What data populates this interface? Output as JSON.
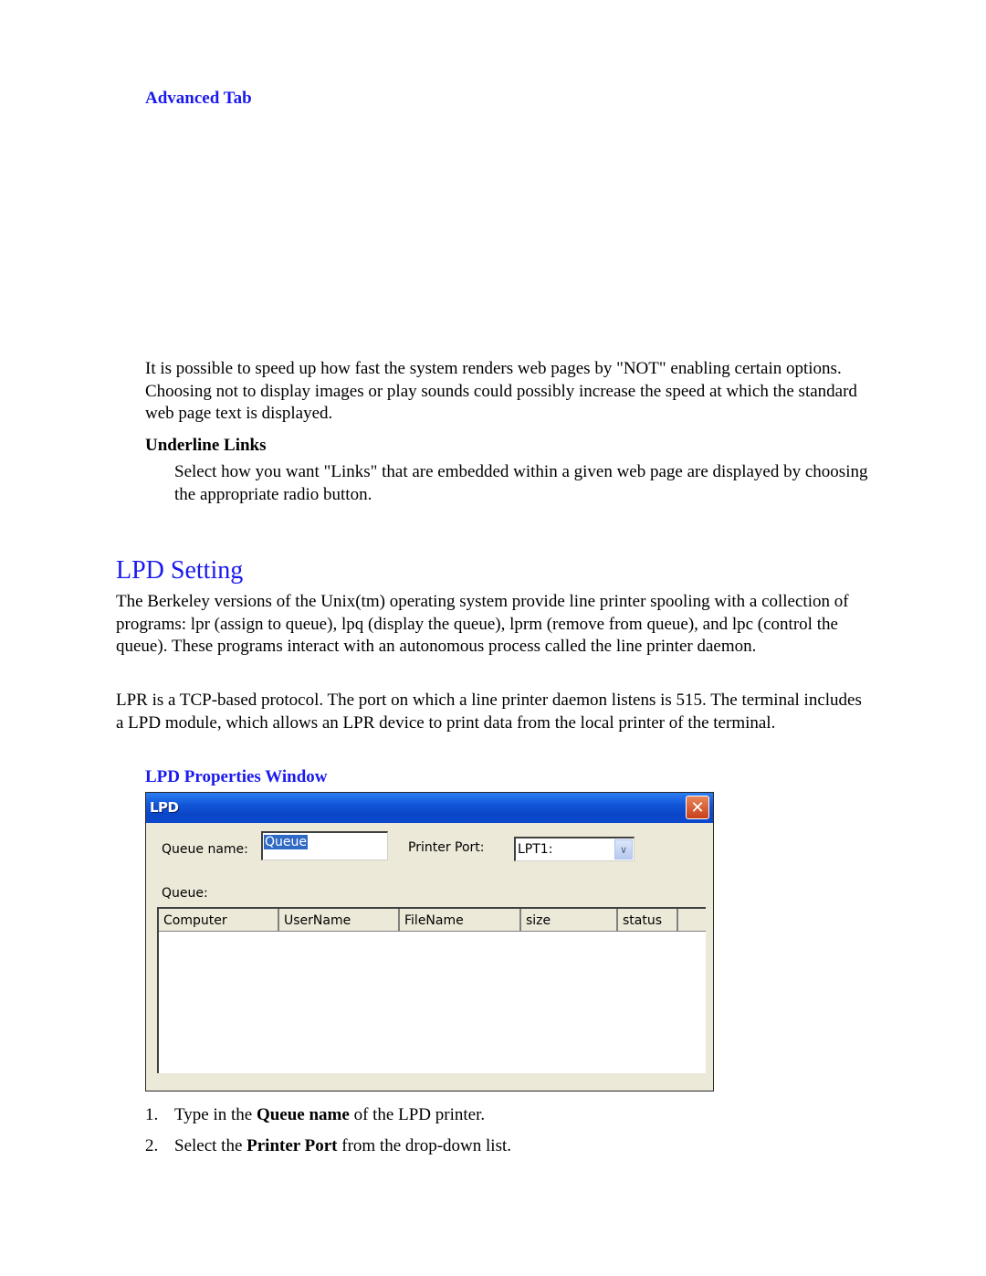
{
  "section_advanced": {
    "heading": "Advanced Tab",
    "paragraph": "It is possible to speed up how fast the system renders web pages by \"NOT\" enabling certain options.  Choosing not to display images or play sounds could possibly increase the speed at which the standard web page text is displayed.",
    "underline_heading": "Underline Links",
    "underline_text": "Select how you want \"Links\" that are embedded within a given web page are displayed by choosing the appropriate radio button."
  },
  "section_lpd": {
    "heading": "LPD Setting",
    "paragraph1": "The Berkeley versions of the Unix(tm) operating system provide line printer spooling with a collection of programs: lpr (assign to queue), lpq (display the queue), lprm (remove from queue), and lpc (control the queue). These programs interact with an autonomous process called the line printer daemon.",
    "paragraph2": "LPR is a TCP-based protocol. The port on which a line printer daemon listens is 515. The terminal includes a LPD module, which allows an LPR device to print data from the local printer of the terminal.",
    "window_heading": "LPD Properties Window"
  },
  "dialog": {
    "title": "LPD",
    "close_icon": "close-x-icon",
    "queue_name_label": "Queue name:",
    "queue_name_value": "Queue",
    "printer_port_label": "Printer Port:",
    "printer_port_value": "LPT1:",
    "dropdown_icon": "chevron-down-icon",
    "queue_label": "Queue:",
    "columns": [
      "Computer",
      "UserName",
      "FileName",
      "size",
      "status"
    ],
    "rows": []
  },
  "steps": [
    {
      "num": "1.",
      "pre": "Type in the ",
      "bold": "Queue name",
      "post": " of the LPD printer."
    },
    {
      "num": "2.",
      "pre": "Select the ",
      "bold": "Printer Port",
      "post": " from the drop-down list."
    }
  ]
}
